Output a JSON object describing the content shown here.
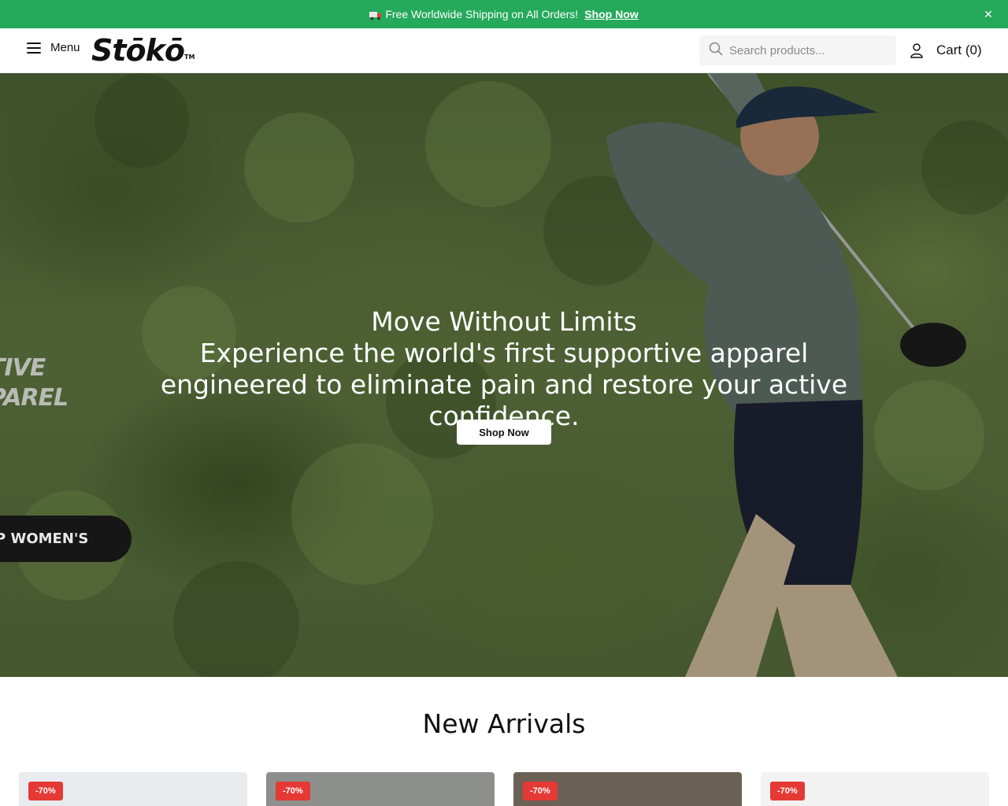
{
  "announcement": {
    "icon": "truck-icon",
    "text": "Free Worldwide Shipping on All Orders!",
    "link_label": "Shop Now",
    "close_icon": "close-icon",
    "bg_color": "#25a95b"
  },
  "header": {
    "menu_label": "Menu",
    "logo_text": "Stōkō",
    "logo_tm": "TM",
    "search_placeholder": "Search products...",
    "cart_label": "Cart (0)"
  },
  "hero": {
    "title": "Move Without Limits",
    "subtitle": "Experience the world's first supportive apparel engineered to eliminate pain and restore your active confidence.",
    "cta_label": "Shop Now",
    "promo_text_line1": "TIVE",
    "promo_text_line2": "PAREL",
    "promo_pill_label": "P WOMEN'S"
  },
  "new_arrivals": {
    "title": "New Arrivals",
    "products": [
      {
        "badge": "-70%",
        "bg": "#e9ecef"
      },
      {
        "badge": "-70%",
        "bg": "#8d8f8c"
      },
      {
        "badge": "-70%",
        "bg": "#6b6154"
      },
      {
        "badge": "-70%",
        "bg": "#f2f2f2"
      }
    ]
  }
}
